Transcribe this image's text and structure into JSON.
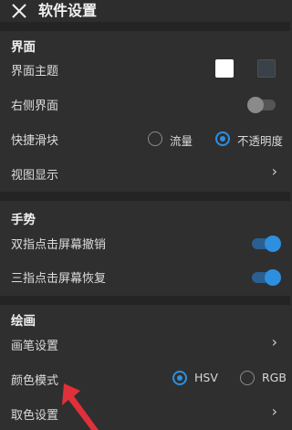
{
  "header": {
    "title": "软件设置",
    "close_icon": "close-icon"
  },
  "sections": {
    "interface": {
      "title": "界面",
      "theme_label": "界面主题",
      "theme_colors": [
        "#ffffff",
        "#3b4148"
      ],
      "right_side_label": "右侧界面",
      "right_side_on": false,
      "quick_slider_label": "快捷滑块",
      "quick_slider_options": [
        "流量",
        "不透明度"
      ],
      "quick_slider_selected": "不透明度",
      "view_display_label": "视图显示"
    },
    "gestures": {
      "title": "手势",
      "two_finger_label": "双指点击屏幕撤销",
      "two_finger_on": true,
      "three_finger_label": "三指点击屏幕恢复",
      "three_finger_on": true
    },
    "drawing": {
      "title": "绘画",
      "brush_label": "画笔设置",
      "color_mode_label": "颜色模式",
      "color_mode_options": [
        "HSV",
        "RGB"
      ],
      "color_mode_selected": "HSV",
      "pick_color_label": "取色设置"
    }
  },
  "colors": {
    "accent": "#2e8fe0",
    "background": "#2d2d2d",
    "divider": "#242424",
    "arrow": "#e0303a"
  }
}
